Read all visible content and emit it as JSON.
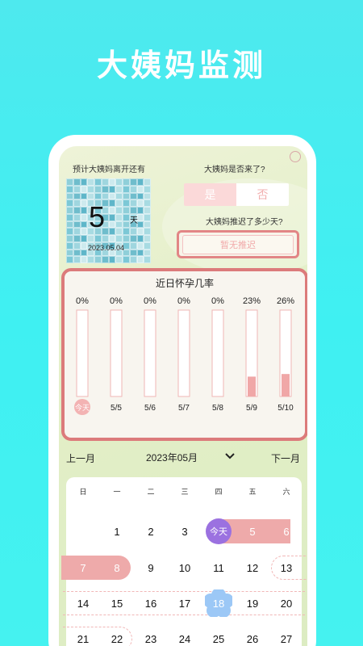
{
  "promo": {
    "title": "大姨妈监测"
  },
  "left_panel": {
    "label": "预计大姨妈离开还有",
    "days": "5",
    "unit": "天",
    "date": "2023.05.04"
  },
  "right_panel": {
    "question1": "大姨妈是否来了?",
    "yes": "是",
    "no": "否",
    "question2": "大姨妈推迟了多少天?",
    "delay_value": "暂无推迟"
  },
  "chart_data": {
    "type": "bar",
    "title": "近日怀孕几率",
    "categories": [
      "今天",
      "5/5",
      "5/6",
      "5/7",
      "5/8",
      "5/9",
      "5/10"
    ],
    "values": [
      0,
      0,
      0,
      0,
      0,
      23,
      26
    ],
    "value_labels": [
      "0%",
      "0%",
      "0%",
      "0%",
      "0%",
      "23%",
      "26%"
    ],
    "ylim": [
      0,
      100
    ],
    "colors": {
      "fill": "#f0a7a7",
      "track_border": "#efb6b6",
      "today_badge": "#f3b3b3"
    }
  },
  "calendar": {
    "prev": "上一月",
    "current": "2023年05月",
    "next": "下一月",
    "weekdays": [
      "日",
      "一",
      "二",
      "三",
      "四",
      "五",
      "六"
    ],
    "rows": [
      [
        "",
        "1",
        "2",
        "3",
        "今天",
        "5",
        "6"
      ],
      [
        "7",
        "8",
        "9",
        "10",
        "11",
        "12",
        "13"
      ],
      [
        "14",
        "15",
        "16",
        "17",
        "18",
        "19",
        "20"
      ],
      [
        "21",
        "22",
        "23",
        "24",
        "25",
        "26",
        "27"
      ]
    ],
    "colors": {
      "period": "#eeaaaa",
      "today": "#9b71e0",
      "ovulation": "#9cc8f6",
      "fertile_dash": "#f1b7b7"
    }
  }
}
